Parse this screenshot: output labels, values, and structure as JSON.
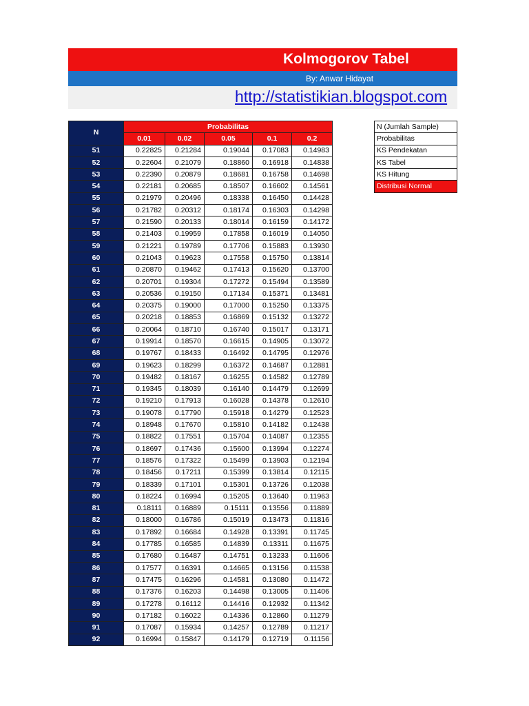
{
  "header": {
    "title": "Kolmogorov Tabel",
    "author": "By: Anwar Hidayat",
    "url": "http://statistikian.blogspot.com"
  },
  "table": {
    "n_header": "N",
    "group_header": "Probabilitas",
    "columns": [
      "0.01",
      "0.02",
      "0.05",
      "0.1",
      "0.2"
    ],
    "rows": [
      [
        "51",
        "0.22825",
        "0.21284",
        "0.19044",
        "0.17083",
        "0.14983"
      ],
      [
        "52",
        "0.22604",
        "0.21079",
        "0.18860",
        "0.16918",
        "0.14838"
      ],
      [
        "53",
        "0.22390",
        "0.20879",
        "0.18681",
        "0.16758",
        "0.14698"
      ],
      [
        "54",
        "0.22181",
        "0.20685",
        "0.18507",
        "0.16602",
        "0.14561"
      ],
      [
        "55",
        "0.21979",
        "0.20496",
        "0.18338",
        "0.16450",
        "0.14428"
      ],
      [
        "56",
        "0.21782",
        "0.20312",
        "0.18174",
        "0.16303",
        "0.14298"
      ],
      [
        "57",
        "0.21590",
        "0.20133",
        "0.18014",
        "0.16159",
        "0.14172"
      ],
      [
        "58",
        "0.21403",
        "0.19959",
        "0.17858",
        "0.16019",
        "0.14050"
      ],
      [
        "59",
        "0.21221",
        "0.19789",
        "0.17706",
        "0.15883",
        "0.13930"
      ],
      [
        "60",
        "0.21043",
        "0.19623",
        "0.17558",
        "0.15750",
        "0.13814"
      ],
      [
        "61",
        "0.20870",
        "0.19462",
        "0.17413",
        "0.15620",
        "0.13700"
      ],
      [
        "62",
        "0.20701",
        "0.19304",
        "0.17272",
        "0.15494",
        "0.13589"
      ],
      [
        "63",
        "0.20536",
        "0.19150",
        "0.17134",
        "0.15371",
        "0.13481"
      ],
      [
        "64",
        "0.20375",
        "0.19000",
        "0.17000",
        "0.15250",
        "0.13375"
      ],
      [
        "65",
        "0.20218",
        "0.18853",
        "0.16869",
        "0.15132",
        "0.13272"
      ],
      [
        "66",
        "0.20064",
        "0.18710",
        "0.16740",
        "0.15017",
        "0.13171"
      ],
      [
        "67",
        "0.19914",
        "0.18570",
        "0.16615",
        "0.14905",
        "0.13072"
      ],
      [
        "68",
        "0.19767",
        "0.18433",
        "0.16492",
        "0.14795",
        "0.12976"
      ],
      [
        "69",
        "0.19623",
        "0.18299",
        "0.16372",
        "0.14687",
        "0.12881"
      ],
      [
        "70",
        "0.19482",
        "0.18167",
        "0.16255",
        "0.14582",
        "0.12789"
      ],
      [
        "71",
        "0.19345",
        "0.18039",
        "0.16140",
        "0.14479",
        "0.12699"
      ],
      [
        "72",
        "0.19210",
        "0.17913",
        "0.16028",
        "0.14378",
        "0.12610"
      ],
      [
        "73",
        "0.19078",
        "0.17790",
        "0.15918",
        "0.14279",
        "0.12523"
      ],
      [
        "74",
        "0.18948",
        "0.17670",
        "0.15810",
        "0.14182",
        "0.12438"
      ],
      [
        "75",
        "0.18822",
        "0.17551",
        "0.15704",
        "0.14087",
        "0.12355"
      ],
      [
        "76",
        "0.18697",
        "0.17436",
        "0.15600",
        "0.13994",
        "0.12274"
      ],
      [
        "77",
        "0.18576",
        "0.17322",
        "0.15499",
        "0.13903",
        "0.12194"
      ],
      [
        "78",
        "0.18456",
        "0.17211",
        "0.15399",
        "0.13814",
        "0.12115"
      ],
      [
        "79",
        "0.18339",
        "0.17101",
        "0.15301",
        "0.13726",
        "0.12038"
      ],
      [
        "80",
        "0.18224",
        "0.16994",
        "0.15205",
        "0.13640",
        "0.11963"
      ],
      [
        "81",
        "0.18111",
        "0.16889",
        "0.15111",
        "0.13556",
        "0.11889"
      ],
      [
        "82",
        "0.18000",
        "0.16786",
        "0.15019",
        "0.13473",
        "0.11816"
      ],
      [
        "83",
        "0.17892",
        "0.16684",
        "0.14928",
        "0.13391",
        "0.11745"
      ],
      [
        "84",
        "0.17785",
        "0.16585",
        "0.14839",
        "0.13311",
        "0.11675"
      ],
      [
        "85",
        "0.17680",
        "0.16487",
        "0.14751",
        "0.13233",
        "0.11606"
      ],
      [
        "86",
        "0.17577",
        "0.16391",
        "0.14665",
        "0.13156",
        "0.11538"
      ],
      [
        "87",
        "0.17475",
        "0.16296",
        "0.14581",
        "0.13080",
        "0.11472"
      ],
      [
        "88",
        "0.17376",
        "0.16203",
        "0.14498",
        "0.13005",
        "0.11406"
      ],
      [
        "89",
        "0.17278",
        "0.16112",
        "0.14416",
        "0.12932",
        "0.11342"
      ],
      [
        "90",
        "0.17182",
        "0.16022",
        "0.14336",
        "0.12860",
        "0.11279"
      ],
      [
        "91",
        "0.17087",
        "0.15934",
        "0.14257",
        "0.12789",
        "0.11217"
      ],
      [
        "92",
        "0.16994",
        "0.15847",
        "0.14179",
        "0.12719",
        "0.11156"
      ]
    ]
  },
  "legend": [
    {
      "label": "N (Jumlah Sample)",
      "highlight": false
    },
    {
      "label": "Probabilitas",
      "highlight": false
    },
    {
      "label": "KS Pendekatan",
      "highlight": false
    },
    {
      "label": "KS Tabel",
      "highlight": false
    },
    {
      "label": "KS Hitung",
      "highlight": false
    },
    {
      "label": "Distribusi Normal",
      "highlight": true
    }
  ],
  "colors": {
    "title_red": "#ee1111",
    "author_blue": "#1f73c5",
    "n_column_navy": "#0a1e5a",
    "link_blue": "#1515cc"
  }
}
